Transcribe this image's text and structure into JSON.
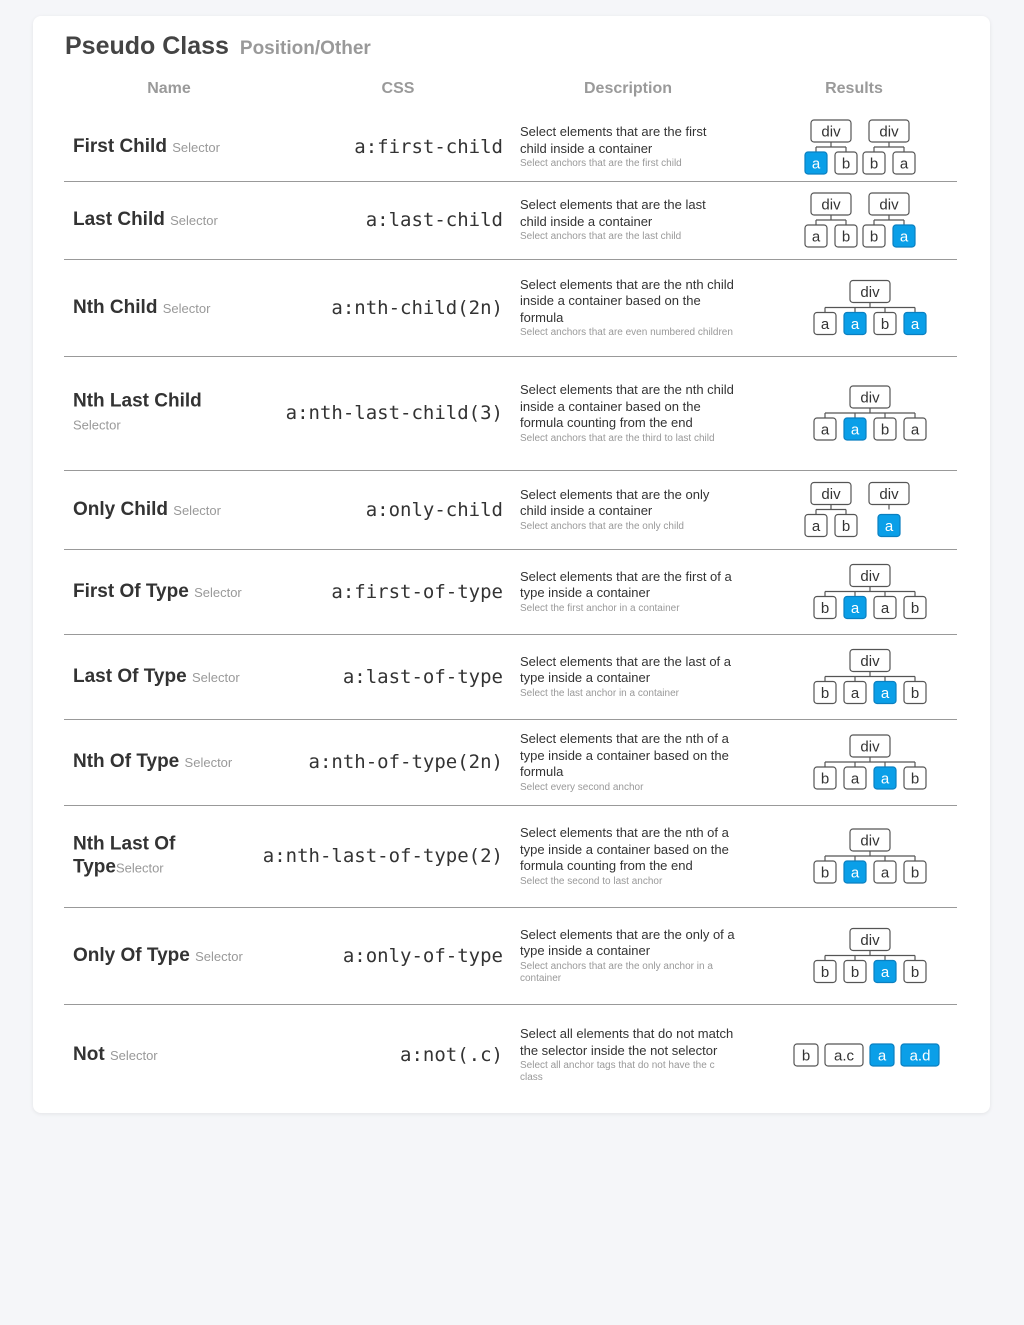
{
  "header": {
    "title": "Pseudo Class",
    "subtitle": "Position/Other"
  },
  "columns": {
    "name": "Name",
    "css": "CSS",
    "description": "Description",
    "results": "Results"
  },
  "selector_word": "Selector",
  "highlight_color": "#0a9fe8",
  "rows": [
    {
      "name": "First Child",
      "css": "a:first-child",
      "desc": "Select elements that are the first child inside a container",
      "note": "Select anchors that are the first child",
      "tree": {
        "groups": [
          {
            "parent": "div",
            "children": [
              "a",
              "b"
            ],
            "selected": [
              0
            ]
          },
          {
            "parent": "div",
            "children": [
              "b",
              "a"
            ],
            "selected": []
          }
        ]
      }
    },
    {
      "name": "Last Child",
      "css": "a:last-child",
      "desc": "Select elements that are the last child inside a container",
      "note": "Select anchors that are the last child",
      "tree": {
        "groups": [
          {
            "parent": "div",
            "children": [
              "a",
              "b"
            ],
            "selected": []
          },
          {
            "parent": "div",
            "children": [
              "b",
              "a"
            ],
            "selected": [
              1
            ]
          }
        ]
      }
    },
    {
      "name": "Nth Child",
      "css": "a:nth-child(2n)",
      "desc": "Select elements that are the nth child inside a container based on the formula",
      "note": "Select anchors that are even numbered children",
      "tree": {
        "groups": [
          {
            "parent": "div",
            "children": [
              "a",
              "a",
              "b",
              "a"
            ],
            "selected": [
              1,
              3
            ]
          }
        ]
      }
    },
    {
      "name": "Nth Last Child",
      "css": "a:nth-last-child(3)",
      "desc": "Select elements that are the nth child inside a container based on the formula counting from the end",
      "note": "Select anchors that are the third to last child",
      "tree": {
        "groups": [
          {
            "parent": "div",
            "children": [
              "a",
              "a",
              "b",
              "a"
            ],
            "selected": [
              1
            ]
          }
        ]
      }
    },
    {
      "name": "Only Child",
      "css": "a:only-child",
      "desc": "Select elements that are the only child inside a container",
      "note": "Select anchors that are the only child",
      "tree": {
        "groups": [
          {
            "parent": "div",
            "children": [
              "a",
              "b"
            ],
            "selected": []
          },
          {
            "parent": "div",
            "children": [
              "a"
            ],
            "selected": [
              0
            ]
          }
        ]
      }
    },
    {
      "name": "First Of Type",
      "css": "a:first-of-type",
      "desc": "Select elements that are the first of a type inside a container",
      "note": "Select the first anchor in a container",
      "tree": {
        "groups": [
          {
            "parent": "div",
            "children": [
              "b",
              "a",
              "a",
              "b"
            ],
            "selected": [
              1
            ]
          }
        ]
      }
    },
    {
      "name": "Last Of Type",
      "css": "a:last-of-type",
      "desc": "Select elements that are the last of a type inside a container",
      "note": "Select the last anchor in a container",
      "tree": {
        "groups": [
          {
            "parent": "div",
            "children": [
              "b",
              "a",
              "a",
              "b"
            ],
            "selected": [
              2
            ]
          }
        ]
      }
    },
    {
      "name": "Nth Of Type",
      "css": "a:nth-of-type(2n)",
      "desc": "Select elements that are the nth of a type inside a container based on the formula",
      "note": "Select every second anchor",
      "tree": {
        "groups": [
          {
            "parent": "div",
            "children": [
              "b",
              "a",
              "a",
              "b"
            ],
            "selected": [
              2
            ]
          }
        ]
      }
    },
    {
      "name": "Nth Last Of Type",
      "css": "a:nth-last-of-type(2)",
      "desc": "Select elements that are the nth of a type inside a container based on the formula counting from the end",
      "note": "Select the second to last anchor",
      "tree": {
        "groups": [
          {
            "parent": "div",
            "children": [
              "b",
              "a",
              "a",
              "b"
            ],
            "selected": [
              1
            ]
          }
        ]
      }
    },
    {
      "name": "Only Of Type",
      "css": "a:only-of-type",
      "desc": "Select elements that are the only of a type inside a container",
      "note": "Select anchors that are the only anchor in a container",
      "tree": {
        "groups": [
          {
            "parent": "div",
            "children": [
              "b",
              "b",
              "a",
              "b"
            ],
            "selected": [
              2
            ]
          }
        ]
      }
    },
    {
      "name": "Not",
      "css": "a:not(.c)",
      "desc": "Select all elements that do not match the selector inside the not selector",
      "note": "Select all anchor tags that do not have the c class",
      "tree": {
        "flat": [
          "b",
          "a.c",
          "a",
          "a.d"
        ],
        "selected": [
          2,
          3
        ]
      }
    }
  ]
}
